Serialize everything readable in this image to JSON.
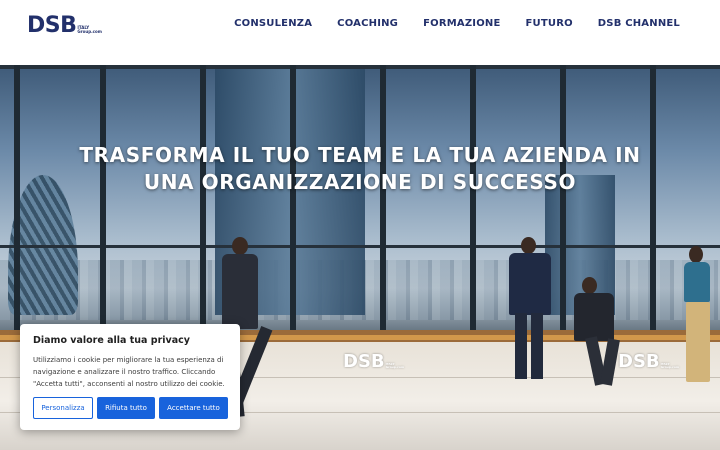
{
  "header": {
    "logo": {
      "main": "DSB",
      "sub_line1": "ITALY",
      "sub_line2": "Group.com"
    },
    "nav": [
      "CONSULENZA",
      "COACHING",
      "FORMAZIONE",
      "FUTURO",
      "DSB CHANNEL"
    ]
  },
  "hero": {
    "title_line1": "TRASFORMA IL TUO TEAM E LA TUA AZIENDA IN",
    "title_line2": "UNA ORGANIZZAZIONE DI SUCCESSO",
    "bench_logo": {
      "main": "DSB",
      "sub_line1": "ITALY",
      "sub_line2": "Group.com"
    }
  },
  "cookie_banner": {
    "title": "Diamo valore alla tua privacy",
    "text": "Utilizziamo i cookie per migliorare la tua esperienza di navigazione e analizzare il nostro traffico. Cliccando \"Accetta tutti\", acconsenti al nostro utilizzo dei cookie.",
    "buttons": {
      "customize": "Personalizza",
      "reject": "Rifiuta tutto",
      "accept": "Accettare tutto"
    }
  },
  "colors": {
    "brand": "#22306b",
    "accent": "#1863dc"
  }
}
